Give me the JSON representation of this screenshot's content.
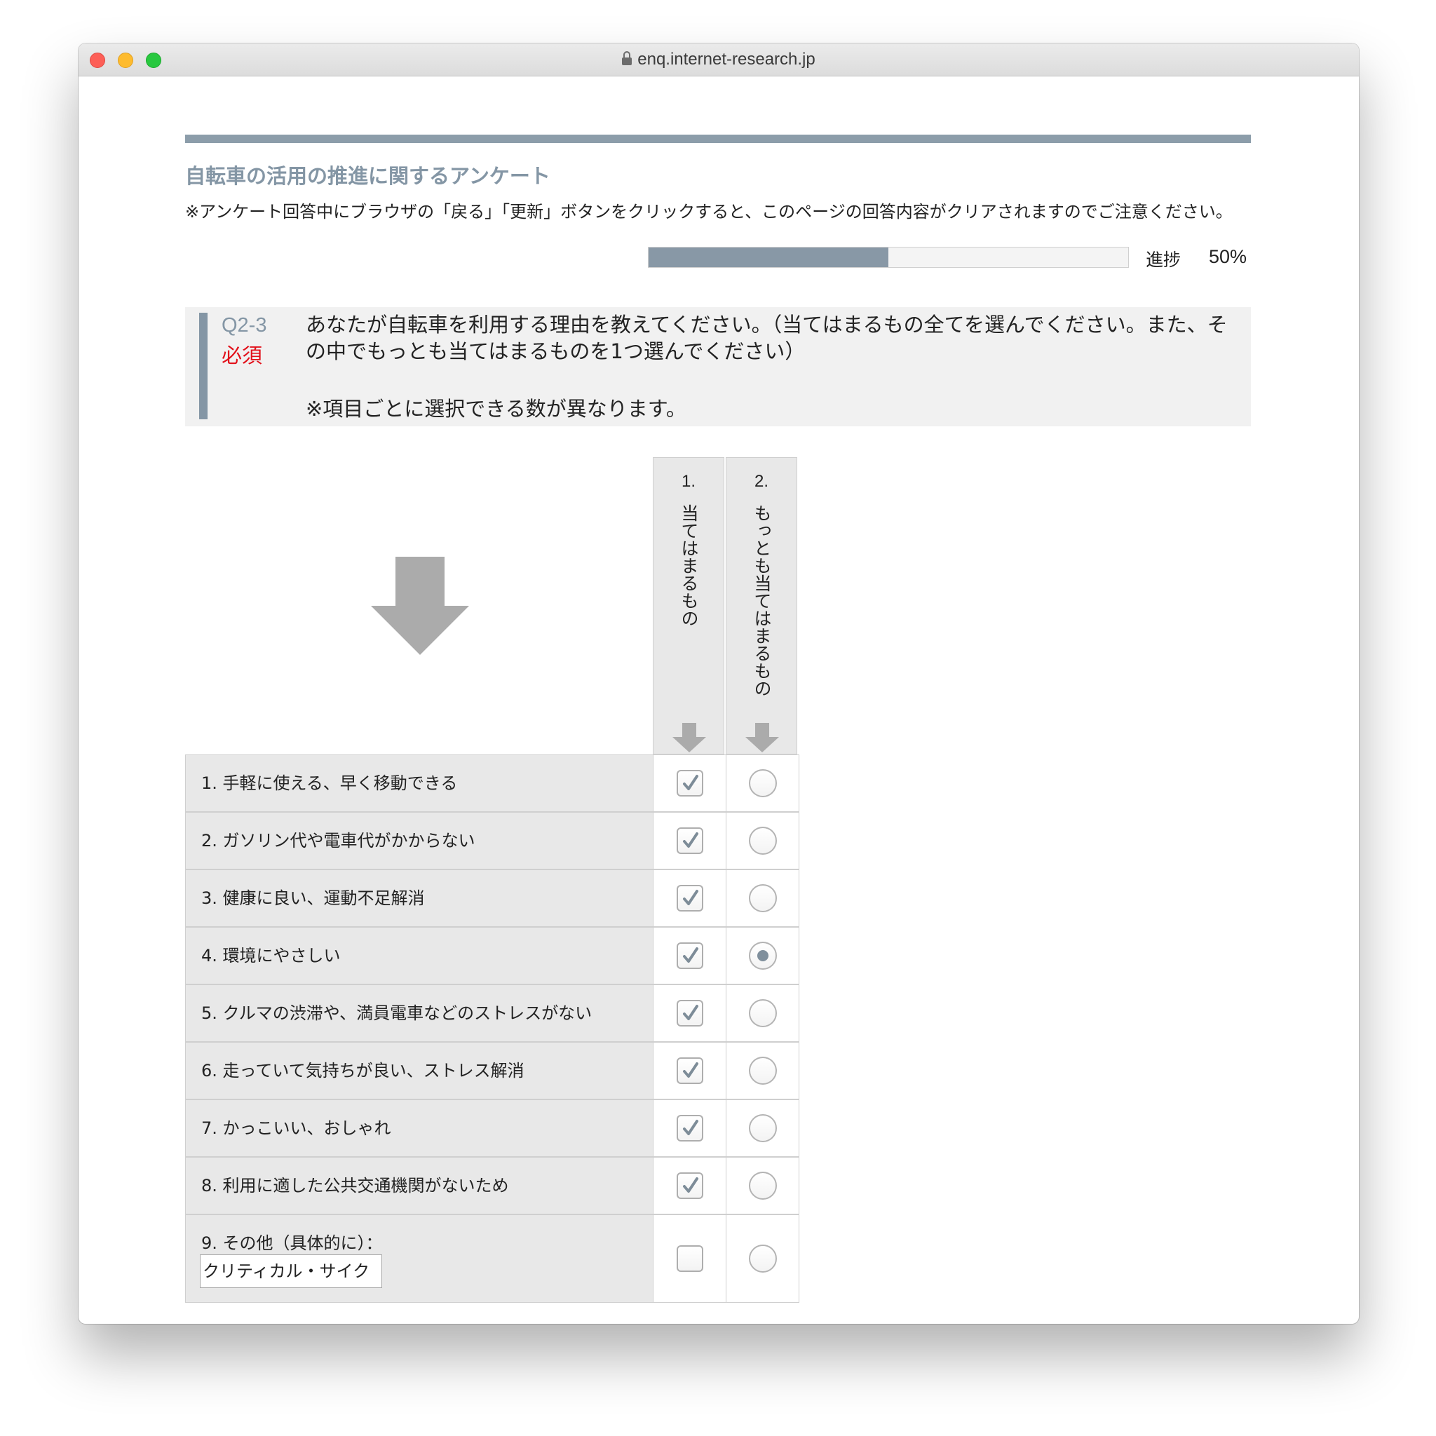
{
  "browser": {
    "url": "enq.internet-research.jp"
  },
  "survey": {
    "title": "自転車の活用の推進に関するアンケート",
    "notice": "※アンケート回答中にブラウザの「戻る」「更新」ボタンをクリックすると、このページの回答内容がクリアされますのでご注意ください。",
    "progress_label": "進捗",
    "progress_value": "50%",
    "progress_fraction": 0.5
  },
  "question": {
    "number": "Q2-3",
    "required": "必須",
    "text": "あなたが自転車を利用する理由を教えてください。（当てはまるもの全てを選んでください。また、その中でもっとも当てはまるものを1つ選んでください）",
    "note": "※項目ごとに選択できる数が異なります。"
  },
  "columns": [
    {
      "number": "1.",
      "label": "当てはまるもの"
    },
    {
      "number": "2.",
      "label": "もっとも当てはまるもの"
    }
  ],
  "rows": [
    {
      "label": "1. 手軽に使える、早く移動できる",
      "checked": true,
      "selected": false
    },
    {
      "label": "2. ガソリン代や電車代がかからない",
      "checked": true,
      "selected": false
    },
    {
      "label": "3. 健康に良い、運動不足解消",
      "checked": true,
      "selected": false
    },
    {
      "label": "4. 環境にやさしい",
      "checked": true,
      "selected": true
    },
    {
      "label": "5. クルマの渋滞や、満員電車などのストレスがない",
      "checked": true,
      "selected": false
    },
    {
      "label": "6. 走っていて気持ちが良い、ストレス解消",
      "checked": true,
      "selected": false
    },
    {
      "label": "7. かっこいい、おしゃれ",
      "checked": true,
      "selected": false
    },
    {
      "label": "8. 利用に適した公共交通機関がないため",
      "checked": true,
      "selected": false
    },
    {
      "label": "9. その他（具体的に）：",
      "checked": false,
      "selected": false,
      "input_value": "クリティカル・サイク"
    }
  ],
  "colors": {
    "accent": "#8496a5",
    "required": "#e2101a",
    "header_bg": "#e8e8e8"
  }
}
